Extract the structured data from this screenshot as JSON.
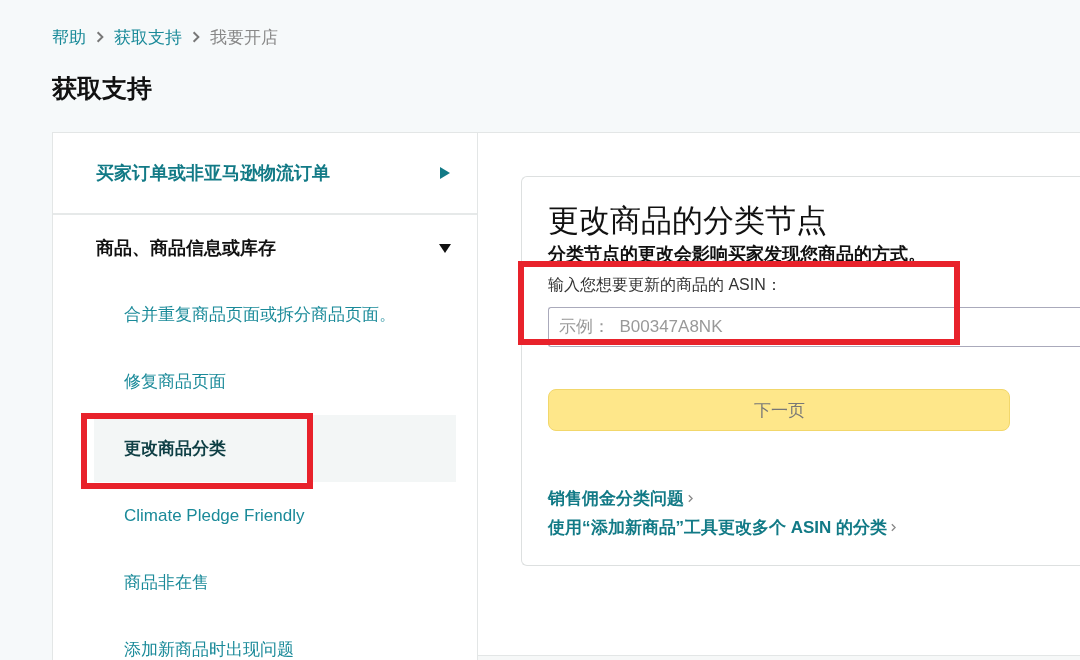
{
  "breadcrumb": [
    {
      "label": "帮助",
      "link": true
    },
    {
      "label": "获取支持",
      "link": true
    },
    {
      "label": "我要开店",
      "link": false
    }
  ],
  "page_title": "获取支持",
  "sidebar": {
    "sections": [
      {
        "label": "买家订单或非亚马逊物流订单",
        "expanded": false
      },
      {
        "label": "商品、商品信息或库存",
        "expanded": true,
        "children": [
          {
            "label": "合并重复商品页面或拆分商品页面。",
            "selected": false,
            "highlighted": false
          },
          {
            "label": "修复商品页面",
            "selected": false,
            "highlighted": false
          },
          {
            "label": "更改商品分类",
            "selected": true,
            "highlighted": true
          },
          {
            "label": "Climate Pledge Friendly",
            "selected": false,
            "highlighted": false
          },
          {
            "label": "商品非在售",
            "selected": false,
            "highlighted": false
          },
          {
            "label": "添加新商品时出现问题",
            "selected": false,
            "highlighted": false
          }
        ]
      }
    ]
  },
  "form": {
    "title": "更改商品的分类节点",
    "subtitle": "分类节点的更改会影响买家发现您商品的方式。",
    "field": {
      "label": "输入您想要更新的商品的 ASIN：",
      "placeholder": "示例：  B00347A8NK",
      "highlighted": true
    },
    "button": {
      "label": "下一页",
      "disabled": true
    },
    "links": [
      "销售佣金分类问题",
      "使用“添加新商品”工具更改多个 ASIN 的分类"
    ]
  }
}
